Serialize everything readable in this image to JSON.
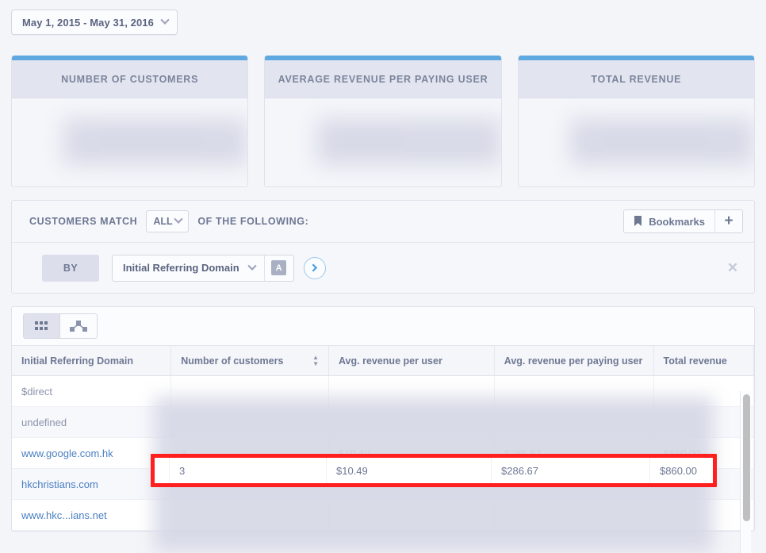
{
  "colors": {
    "accent_blue": "#5fa8e0",
    "link_blue": "#4a7fc1",
    "annotation_red": "#ff1f1f",
    "page_bg": "#f4f5f9",
    "text_muted": "#6e7893"
  },
  "topbar": {
    "date_range": "May 1, 2015 - May 31, 2016",
    "chevron_icon": "chevron-down-icon"
  },
  "cards": [
    {
      "title": "NUMBER OF CUSTOMERS",
      "value": ""
    },
    {
      "title": "AVERAGE REVENUE PER PAYING USER",
      "value": ""
    },
    {
      "title": "TOTAL REVENUE",
      "value": ""
    }
  ],
  "filter": {
    "match_label": "CUSTOMERS MATCH",
    "match_value": "ALL",
    "match_options": [
      "ALL"
    ],
    "following_label": "OF THE FOLLOWING:",
    "bookmarks_label": "Bookmarks",
    "bookmark_icon": "bookmark-icon",
    "add_label": "+",
    "by_label": "BY",
    "attribute_value": "Initial Referring Domain",
    "attribute_type_badge": "A",
    "go_icon": "chevron-right-circle-icon",
    "remove_icon": "close-icon"
  },
  "table": {
    "views": [
      {
        "name": "grid-view",
        "icon": "grid-icon",
        "active": true
      },
      {
        "name": "tree-view",
        "icon": "tree-icon",
        "active": false
      }
    ],
    "columns": [
      {
        "label": "Initial Referring Domain",
        "sortable": false
      },
      {
        "label": "Number of customers",
        "sortable": true
      },
      {
        "label": "Avg. revenue per user",
        "sortable": false
      },
      {
        "label": "Avg. revenue per paying user",
        "sortable": false
      },
      {
        "label": "Total revenue",
        "sortable": false
      }
    ],
    "rows": [
      {
        "domain": "$direct",
        "is_link": false,
        "customers": "",
        "arpu": "",
        "arppu": "",
        "total": "",
        "highlighted": false
      },
      {
        "domain": "undefined",
        "is_link": false,
        "customers": "",
        "arpu": "",
        "arppu": "",
        "total": "",
        "highlighted": false
      },
      {
        "domain": "www.google.com.hk",
        "is_link": true,
        "customers": "3",
        "arpu": "$10.49",
        "arppu": "$286.67",
        "total": "$860.00",
        "highlighted": true
      },
      {
        "domain": "hkchristians.com",
        "is_link": true,
        "customers": "",
        "arpu": "",
        "arppu": "",
        "total": "",
        "highlighted": false
      },
      {
        "domain": "www.hkc...ians.net",
        "is_link": true,
        "customers": "",
        "arpu": "",
        "arppu": "",
        "total": "",
        "highlighted": false
      }
    ]
  }
}
